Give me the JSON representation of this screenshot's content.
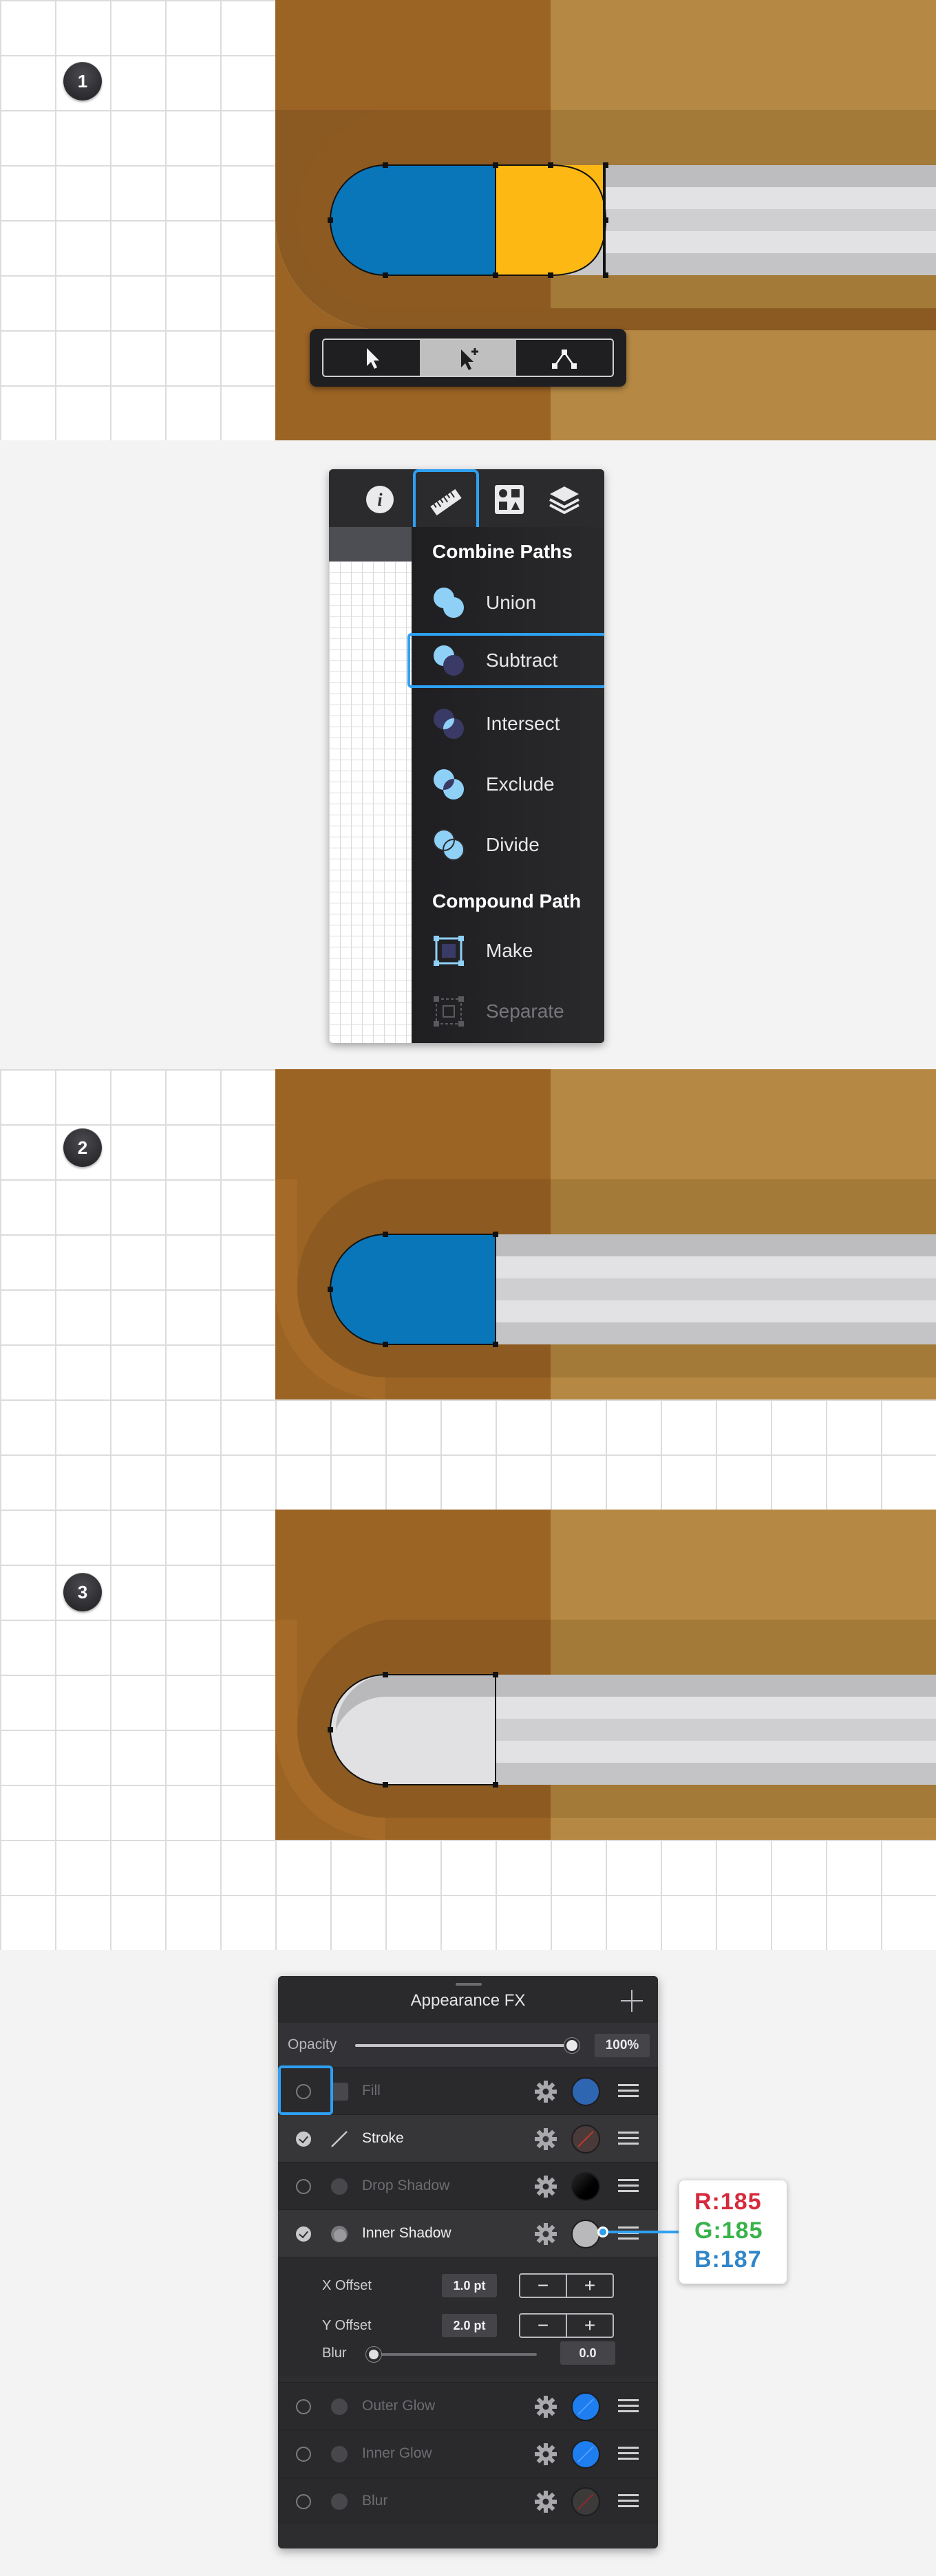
{
  "steps": {
    "one": "1",
    "two": "2",
    "three": "3"
  },
  "toolbar": {
    "tools": [
      {
        "name": "select-tool",
        "active": false
      },
      {
        "name": "direct-select-add-tool",
        "active": true
      },
      {
        "name": "node-tool",
        "active": false
      }
    ]
  },
  "geometry_menu": {
    "tabs": [
      "info-icon",
      "ruler-icon",
      "styles-icon",
      "layers-icon"
    ],
    "active_tab": "ruler-icon",
    "combine_heading": "Combine Paths",
    "combine_items": [
      "Union",
      "Subtract",
      "Intersect",
      "Exclude",
      "Divide"
    ],
    "selected_item": "Subtract",
    "compound_heading": "Compound Path",
    "compound_items": [
      "Make",
      "Separate"
    ],
    "disabled_item": "Separate"
  },
  "appearance": {
    "title": "Appearance FX",
    "opacity_label": "Opacity",
    "opacity_value": "100%",
    "rows": [
      {
        "label": "Fill",
        "enabled": false,
        "color": "#2f66b2"
      },
      {
        "label": "Stroke",
        "enabled": true,
        "color": "#6a3a3a"
      },
      {
        "label": "Drop Shadow",
        "enabled": false,
        "color": "#000000"
      },
      {
        "label": "Inner Shadow",
        "enabled": true,
        "color": "#b9b9bb"
      }
    ],
    "x_offset_label": "X Offset",
    "x_offset_value": "1.0 pt",
    "y_offset_label": "Y Offset",
    "y_offset_value": "2.0 pt",
    "blur_label": "Blur",
    "blur_value": "0.0",
    "stepper_minus": "−",
    "stepper_plus": "+",
    "rows_after": [
      {
        "label": "Outer Glow",
        "enabled": false,
        "color": "#1e7ef0"
      },
      {
        "label": "Inner Glow",
        "enabled": false,
        "color": "#1e7ef0"
      },
      {
        "label": "Blur",
        "enabled": false,
        "color": "#6a3a3a"
      }
    ]
  },
  "rgb_callout": {
    "r": "R:185",
    "g": "G:185",
    "b": "B:187"
  },
  "colors": {
    "wood_dark": "#9b6324",
    "wood_light": "#b58844",
    "blue": "#0976b9",
    "yellow": "#fdb813",
    "gray_light": "#c8c8ca",
    "accent": "#2ea0f2",
    "r": "#d62a3c",
    "g": "#38b24a",
    "b": "#2f86c9"
  }
}
